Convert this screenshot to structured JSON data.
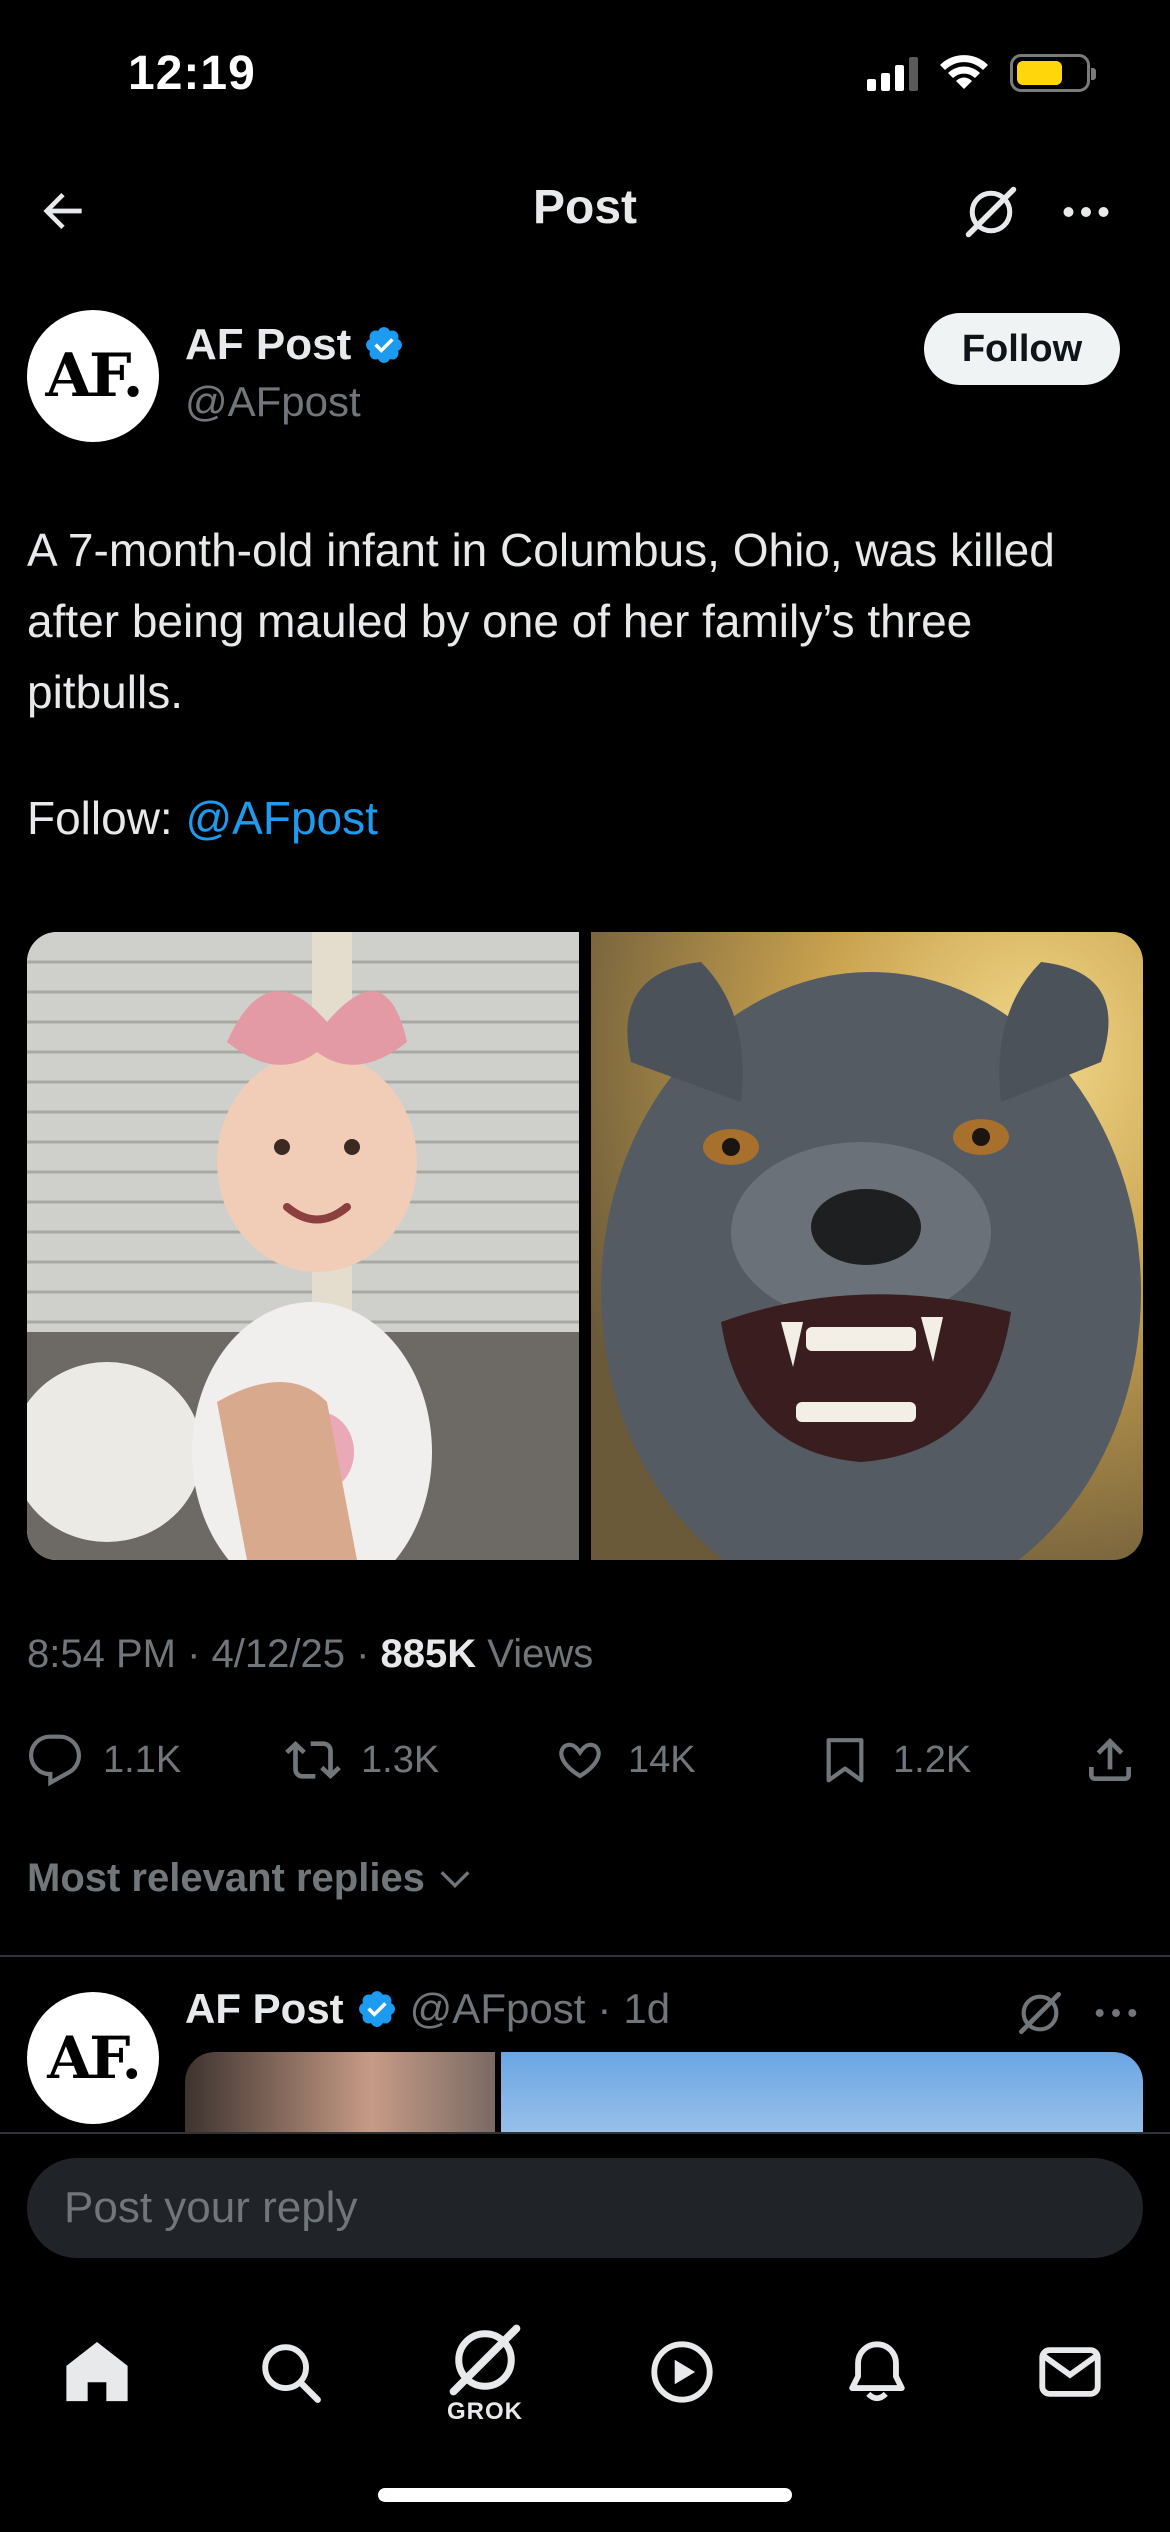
{
  "status_bar": {
    "time": "12:19"
  },
  "header": {
    "title": "Post"
  },
  "post": {
    "avatar_text": "AF.",
    "author_name": "AF Post",
    "author_handle": "@AFpost",
    "follow_label": "Follow",
    "text": "A 7-month-old infant in Columbus, Ohio, was killed after being mauled by one of her family’s three pitbulls.",
    "follow_prefix": "Follow: ",
    "follow_mention": "@AFpost",
    "time": "8:54 PM",
    "date": "4/12/25",
    "views_count": "885K",
    "views_label": "Views",
    "stats": {
      "replies": "1.1K",
      "reposts": "1.3K",
      "likes": "14K",
      "bookmarks": "1.2K"
    }
  },
  "replies_filter": "Most relevant replies",
  "reply": {
    "avatar_text": "AF.",
    "author_name": "AF Post",
    "author_handle": "@AFpost",
    "age": "1d"
  },
  "composer": {
    "placeholder": "Post your reply"
  },
  "tabs": {
    "grok_label": "GROK"
  },
  "colors": {
    "background": "#000000",
    "accent": "#1d9bf0",
    "secondary_text": "#71767b",
    "battery": "#ffd60a"
  }
}
